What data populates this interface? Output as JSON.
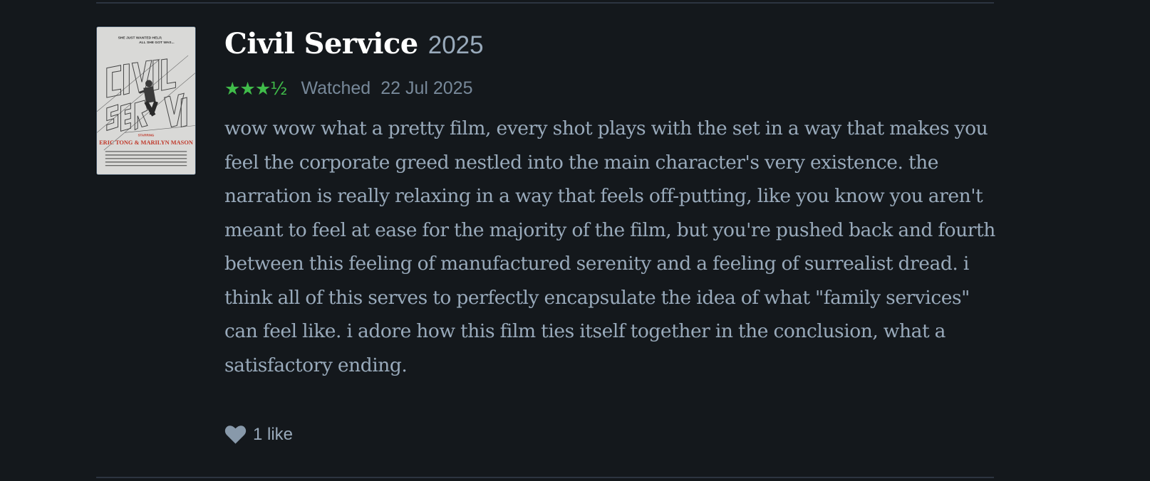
{
  "review": {
    "title": "Civil Service",
    "year": "2025",
    "rating": "★★★½",
    "watched_label": "Watched",
    "watched_date": "22 Jul 2025",
    "text": "wow wow what a pretty film, every shot plays with the set in a way that makes you feel the corporate greed nestled into the main character's very existence. the narration is really relaxing in a way that feels off-putting, like you know you aren't meant to feel at ease for the majority of the film, but you're pushed back and fourth between this feeling of manufactured serenity and a feeling of surrealist dread. i think all of this serves to perfectly encapsulate the idea of what \"family services\" can feel like. i adore how this film ties itself together in the conclusion, what a satisfactory ending.",
    "likes": "1 like"
  },
  "poster": {
    "tagline_1": "SHE JUST WANTED HELP,",
    "tagline_2": "ALL SHE GOT WAS...",
    "starring": "STARRING",
    "cast": "ERIC TONG & MARILYN MASON"
  },
  "colors": {
    "background": "#14181c",
    "rating_green": "#40bc4a",
    "title": "#ffffff",
    "muted": "#99aabb"
  },
  "icons": {
    "like": "heart-icon"
  }
}
